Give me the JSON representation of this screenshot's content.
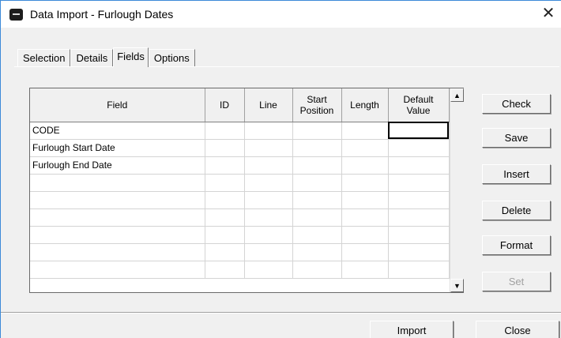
{
  "window": {
    "title": "Data Import - Furlough Dates",
    "close_glyph": "✕"
  },
  "tabs": [
    {
      "label": "Selection",
      "active": false
    },
    {
      "label": "Details",
      "active": false
    },
    {
      "label": "Fields",
      "active": true
    },
    {
      "label": "Options",
      "active": false
    }
  ],
  "grid": {
    "columns": [
      "Field",
      "ID",
      "Line",
      "Start Position",
      "Length",
      "Default Value"
    ],
    "rows": [
      [
        "CODE",
        "",
        "",
        "",
        "",
        ""
      ],
      [
        "Furlough Start Date",
        "",
        "",
        "",
        "",
        ""
      ],
      [
        "Furlough End Date",
        "",
        "",
        "",
        "",
        ""
      ],
      [
        "",
        "",
        "",
        "",
        "",
        ""
      ],
      [
        "",
        "",
        "",
        "",
        "",
        ""
      ],
      [
        "",
        "",
        "",
        "",
        "",
        ""
      ],
      [
        "",
        "",
        "",
        "",
        "",
        ""
      ],
      [
        "",
        "",
        "",
        "",
        "",
        ""
      ],
      [
        "",
        "",
        "",
        "",
        "",
        ""
      ]
    ],
    "selected_cell": "Default Value / CODE"
  },
  "scrollbar": {
    "up_glyph": "▲",
    "down_glyph": "▼"
  },
  "side_buttons": {
    "check": "Check",
    "save": "Save",
    "insert": "Insert",
    "delete": "Delete",
    "format": "Format",
    "set": "Set"
  },
  "bottom_buttons": {
    "import": "Import",
    "close": "Close"
  },
  "colors": {
    "dialog_face": "#f0f0f0",
    "window_border": "#3c8ad8",
    "disabled_text": "#a0a0a0"
  }
}
